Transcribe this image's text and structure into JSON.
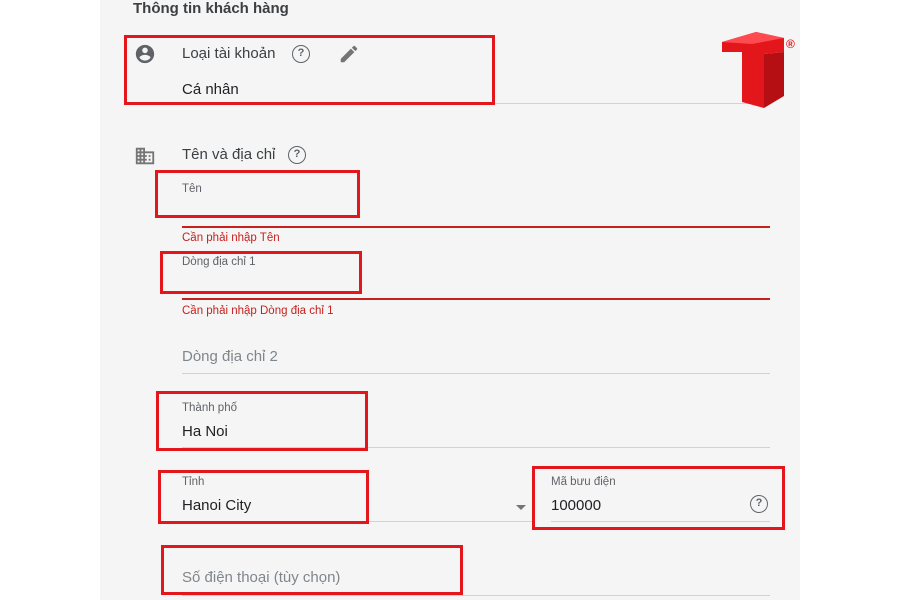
{
  "section": {
    "title": "Thông tin khách hàng"
  },
  "account_type": {
    "label": "Loại tài khoản",
    "value": "Cá nhân",
    "icon": "account-circle-icon",
    "help_glyph": "?",
    "edit_icon": "pencil-icon"
  },
  "name_address": {
    "label": "Tên và địa chỉ",
    "icon": "building-icon",
    "help_glyph": "?"
  },
  "fields": {
    "name": {
      "label": "Tên",
      "error": "Cần phải nhập Tên"
    },
    "address1": {
      "label": "Dòng địa chỉ 1",
      "error": "Cần phải nhập Dòng địa chỉ 1"
    },
    "address2": {
      "placeholder": "Dòng địa chỉ 2"
    },
    "city": {
      "label": "Thành phố",
      "value": "Ha Noi"
    },
    "province": {
      "label": "Tỉnh",
      "value": "Hanoi City"
    },
    "postal": {
      "label": "Mã bưu điện",
      "value": "100000",
      "help_glyph": "?"
    },
    "phone": {
      "placeholder": "Số điện thoại (tùy chọn)"
    }
  },
  "logo": {
    "registered_mark": "®"
  },
  "colors": {
    "highlight": "#e3161c",
    "error": "#c5221f",
    "panel": "#f5f5f5",
    "logo_red": "#e3161c"
  }
}
